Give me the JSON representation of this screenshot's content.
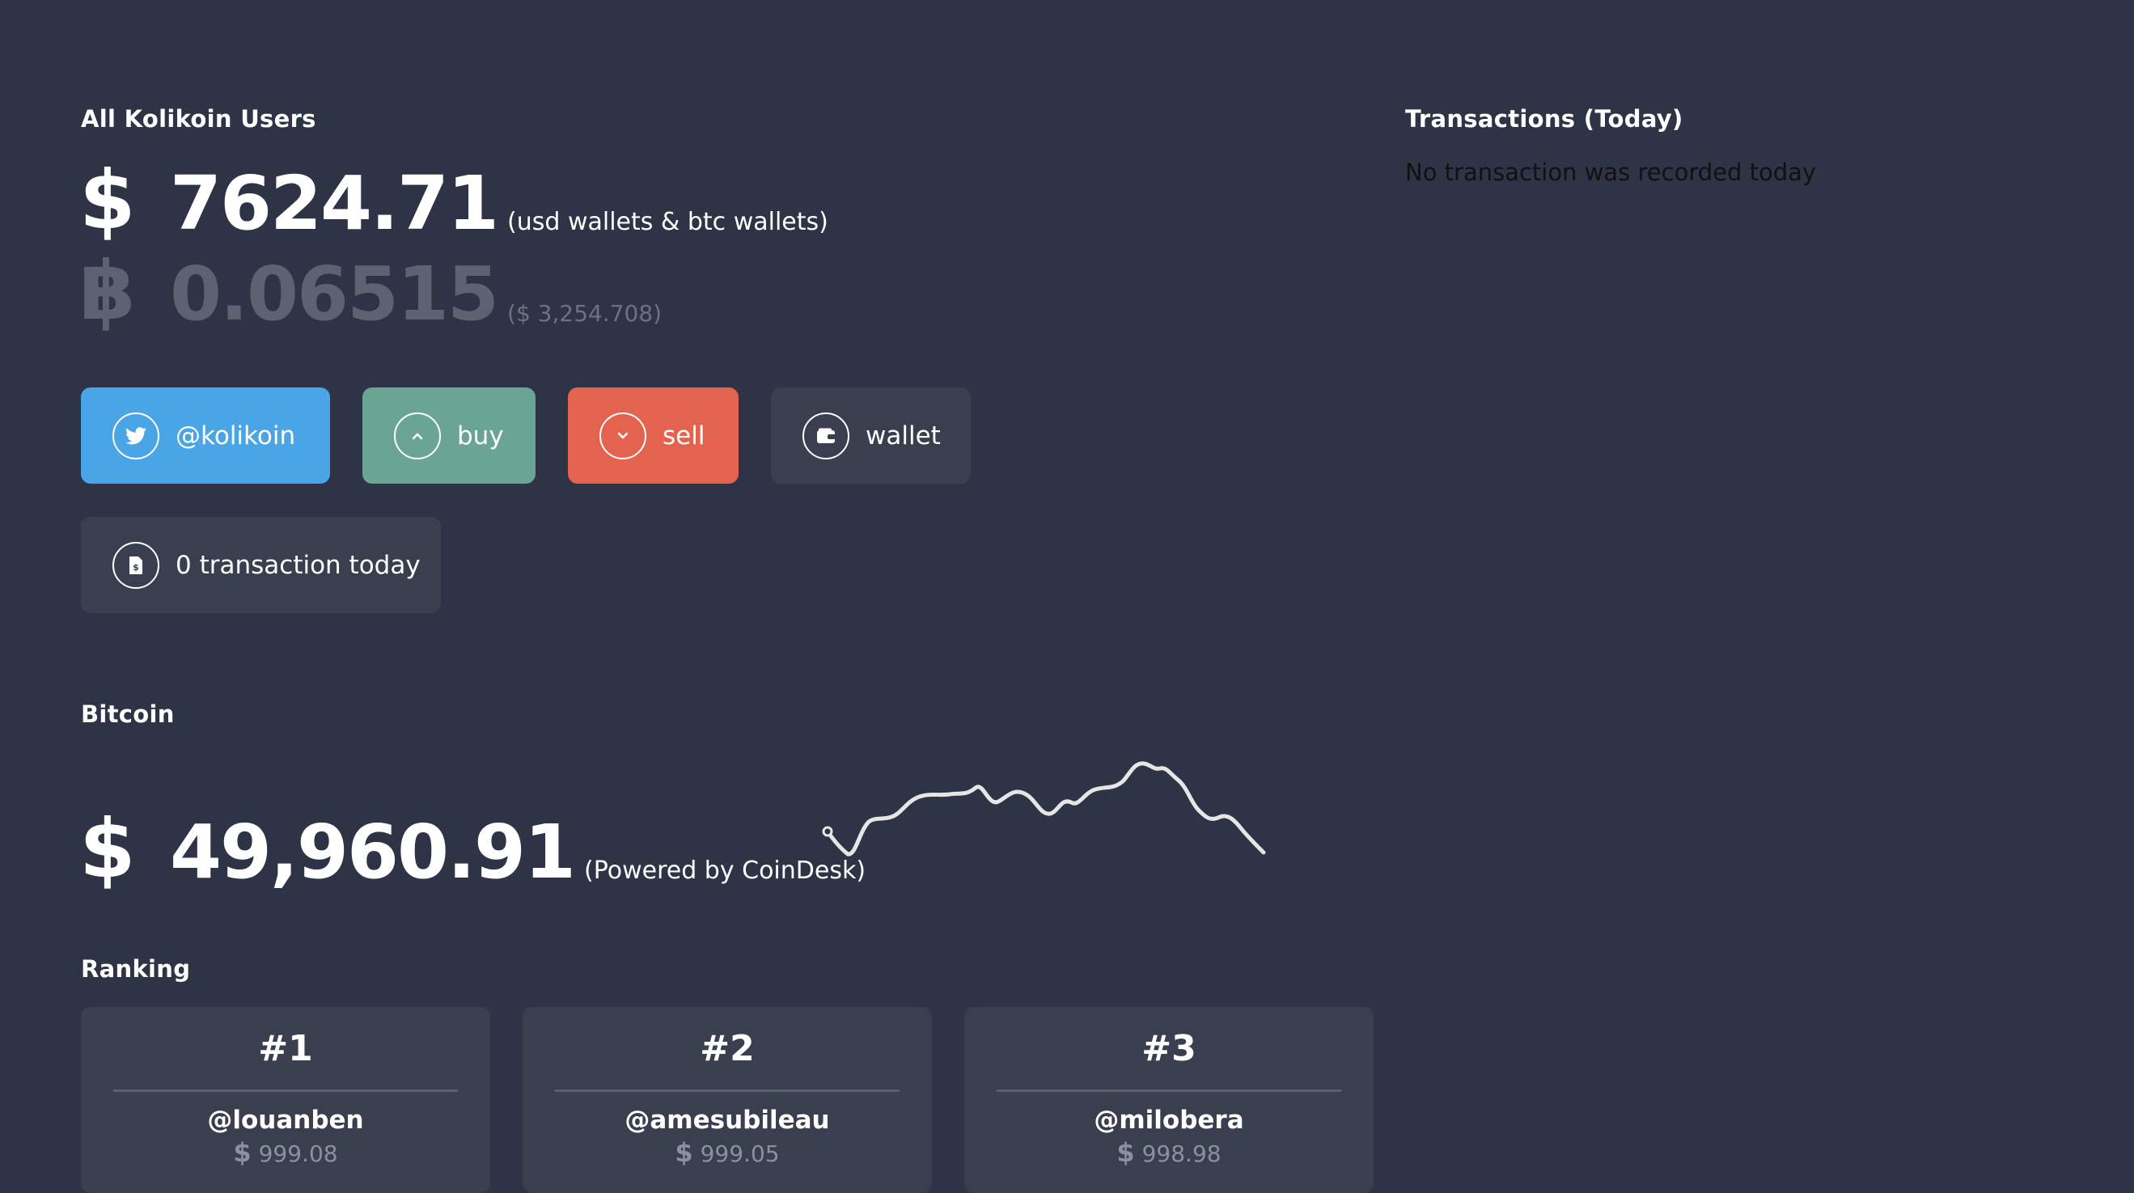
{
  "summary": {
    "title": "All Kolikoin Users",
    "usd_symbol": "$",
    "usd_total": "7624.71",
    "usd_note": "(usd wallets & btc wallets)",
    "btc_symbol": "฿",
    "btc_total": "0.06515",
    "btc_note": "($ 3,254.708)"
  },
  "actions": {
    "twitter_label": "@kolikoin",
    "buy_label": "buy",
    "sell_label": "sell",
    "wallet_label": "wallet",
    "transactions_label": "0 transaction today"
  },
  "bitcoin": {
    "title": "Bitcoin",
    "symbol": "$",
    "price": "49,960.91",
    "note": "(Powered by CoinDesk)"
  },
  "ranking": {
    "title": "Ranking",
    "entries": [
      {
        "position": "#1",
        "user": "@louanben",
        "currency": "$",
        "amount": "999.08"
      },
      {
        "position": "#2",
        "user": "@amesubileau",
        "currency": "$",
        "amount": "999.05"
      },
      {
        "position": "#3",
        "user": "@milobera",
        "currency": "$",
        "amount": "998.98"
      }
    ]
  },
  "transactions": {
    "title": "Transactions (Today)",
    "empty_message": "No transaction was recorded today"
  },
  "colors": {
    "background": "#2e3345",
    "twitter": "#4aa5e6",
    "buy": "#6aa493",
    "sell": "#e3634f",
    "dark_button": "#3a3f4f"
  },
  "icons": {
    "twitter": "twitter-bird-icon",
    "buy": "chevron-up-icon",
    "sell": "chevron-down-icon",
    "wallet": "wallet-icon",
    "transactions": "document-dollar-icon"
  }
}
